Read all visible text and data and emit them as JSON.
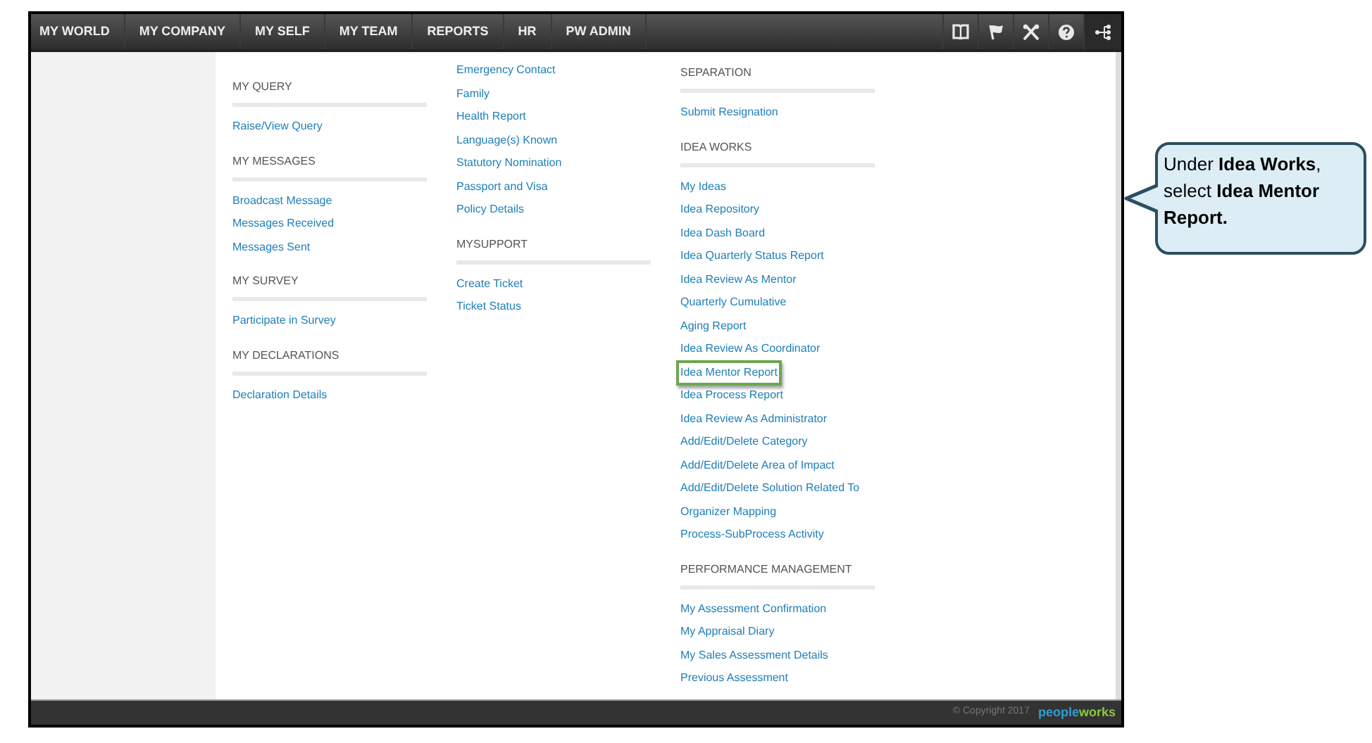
{
  "nav": {
    "items": [
      {
        "label": "MY WORLD"
      },
      {
        "label": "MY COMPANY"
      },
      {
        "label": "MY SELF"
      },
      {
        "label": "MY TEAM"
      },
      {
        "label": "REPORTS"
      },
      {
        "label": "HR"
      },
      {
        "label": "PW ADMIN"
      }
    ],
    "icons": [
      {
        "kind": "book",
        "selected": false
      },
      {
        "kind": "flag",
        "selected": false
      },
      {
        "kind": "tools",
        "selected": false
      },
      {
        "kind": "help",
        "selected": false
      },
      {
        "kind": "sitemap",
        "selected": true
      }
    ]
  },
  "columns": [
    {
      "sections": [
        {
          "heading": "MY QUERY",
          "links": [
            {
              "label": "Raise/View Query",
              "highlighted": false
            }
          ]
        },
        {
          "heading": "MY MESSAGES",
          "links": [
            {
              "label": "Broadcast Message",
              "highlighted": false
            },
            {
              "label": "Messages Received",
              "highlighted": false
            },
            {
              "label": "Messages Sent",
              "highlighted": false
            }
          ]
        },
        {
          "heading": "MY SURVEY",
          "links": [
            {
              "label": "Participate in Survey",
              "highlighted": false
            }
          ]
        },
        {
          "heading": "MY DECLARATIONS",
          "links": [
            {
              "label": "Declaration Details",
              "highlighted": false
            }
          ]
        }
      ]
    },
    {
      "sections": [
        {
          "links": [
            {
              "label": "Emergency Contact",
              "highlighted": false
            },
            {
              "label": "Family",
              "highlighted": false
            },
            {
              "label": "Health Report",
              "highlighted": false
            },
            {
              "label": "Language(s) Known",
              "highlighted": false
            },
            {
              "label": "Statutory Nomination",
              "highlighted": false
            },
            {
              "label": "Passport and Visa",
              "highlighted": false
            },
            {
              "label": "Policy Details",
              "highlighted": false
            }
          ]
        },
        {
          "heading": "MYSUPPORT",
          "links": [
            {
              "label": "Create Ticket",
              "highlighted": false
            },
            {
              "label": "Ticket Status",
              "highlighted": false
            }
          ]
        }
      ]
    },
    {
      "sections": [
        {
          "heading": "SEPARATION",
          "links": [
            {
              "label": "Submit Resignation",
              "highlighted": false
            }
          ]
        },
        {
          "heading": "IDEA WORKS",
          "links": [
            {
              "label": "My Ideas",
              "highlighted": false
            },
            {
              "label": "Idea Repository",
              "highlighted": false
            },
            {
              "label": "Idea Dash Board",
              "highlighted": false
            },
            {
              "label": "Idea Quarterly Status Report",
              "highlighted": false
            },
            {
              "label": "Idea Review As Mentor",
              "highlighted": false
            },
            {
              "label": "Quarterly Cumulative",
              "highlighted": false
            },
            {
              "label": "Aging Report",
              "highlighted": false
            },
            {
              "label": "Idea Review As Coordinator",
              "highlighted": false
            },
            {
              "label": "Idea Mentor Report",
              "highlighted": true
            },
            {
              "label": "Idea Process Report",
              "highlighted": false
            },
            {
              "label": "Idea Review As Administrator",
              "highlighted": false
            },
            {
              "label": "Add/Edit/Delete Category",
              "highlighted": false
            },
            {
              "label": "Add/Edit/Delete Area of Impact",
              "highlighted": false
            },
            {
              "label": "Add/Edit/Delete Solution Related To",
              "highlighted": false
            },
            {
              "label": "Organizer Mapping",
              "highlighted": false
            },
            {
              "label": "Process-SubProcess Activity",
              "highlighted": false
            }
          ]
        },
        {
          "heading": "PERFORMANCE MANAGEMENT",
          "links": [
            {
              "label": "My Assessment Confirmation",
              "highlighted": false
            },
            {
              "label": "My Appraisal Diary",
              "highlighted": false
            },
            {
              "label": "My Sales Assessment Details",
              "highlighted": false
            },
            {
              "label": "Previous Assessment",
              "highlighted": false
            }
          ]
        }
      ]
    }
  ],
  "footer": {
    "copyright": "© Copyright 2017",
    "logo": {
      "part_1": "people",
      "part_2": "works"
    }
  },
  "callout": {
    "text": "Under **Idea Works**, select **Idea Mentor Report.**"
  }
}
